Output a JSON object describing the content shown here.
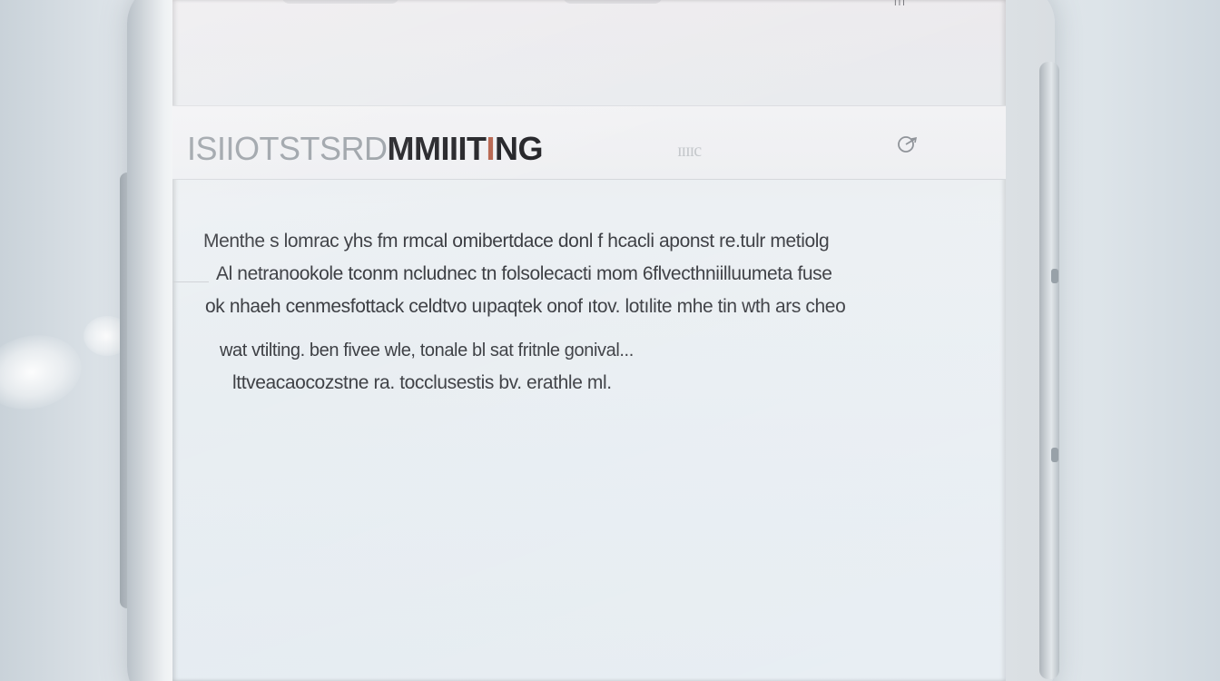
{
  "app": {
    "title_faint": "ISIIOTSTSRD",
    "title_bold": "MMIIIT",
    "title_accent": "I",
    "title_tail": "NG",
    "subtab": "ɪɪɪɪc",
    "status_indicator": "|||"
  },
  "icons": {
    "settings": "settings-icon"
  },
  "body": {
    "lines": [
      "Menthe s lomrac yhs fm rmcal omibertdace donl f hcacli aponst re.tulr metiolg",
      "Al netranookole tconm ncludnec tn folsolecacti mom  6flvecthniilluumeta fuse",
      "ok nhaeh cenmesfottack celdtvo uıpaqtek onof  ıtov. lotılite mhe tin wth ars cheo",
      "wat vtilting. ben  fivee wle, tonale bl sat  fritnle gonival...",
      "lttveacaocozstne ra. tocclusestis bv. erathle ml."
    ]
  },
  "colors": {
    "title": "#1e1e22",
    "title_faint": "#9aa0a6",
    "accent": "#b5614a",
    "body_text": "#3b3d42",
    "screen_bg": "#e9eef2"
  }
}
